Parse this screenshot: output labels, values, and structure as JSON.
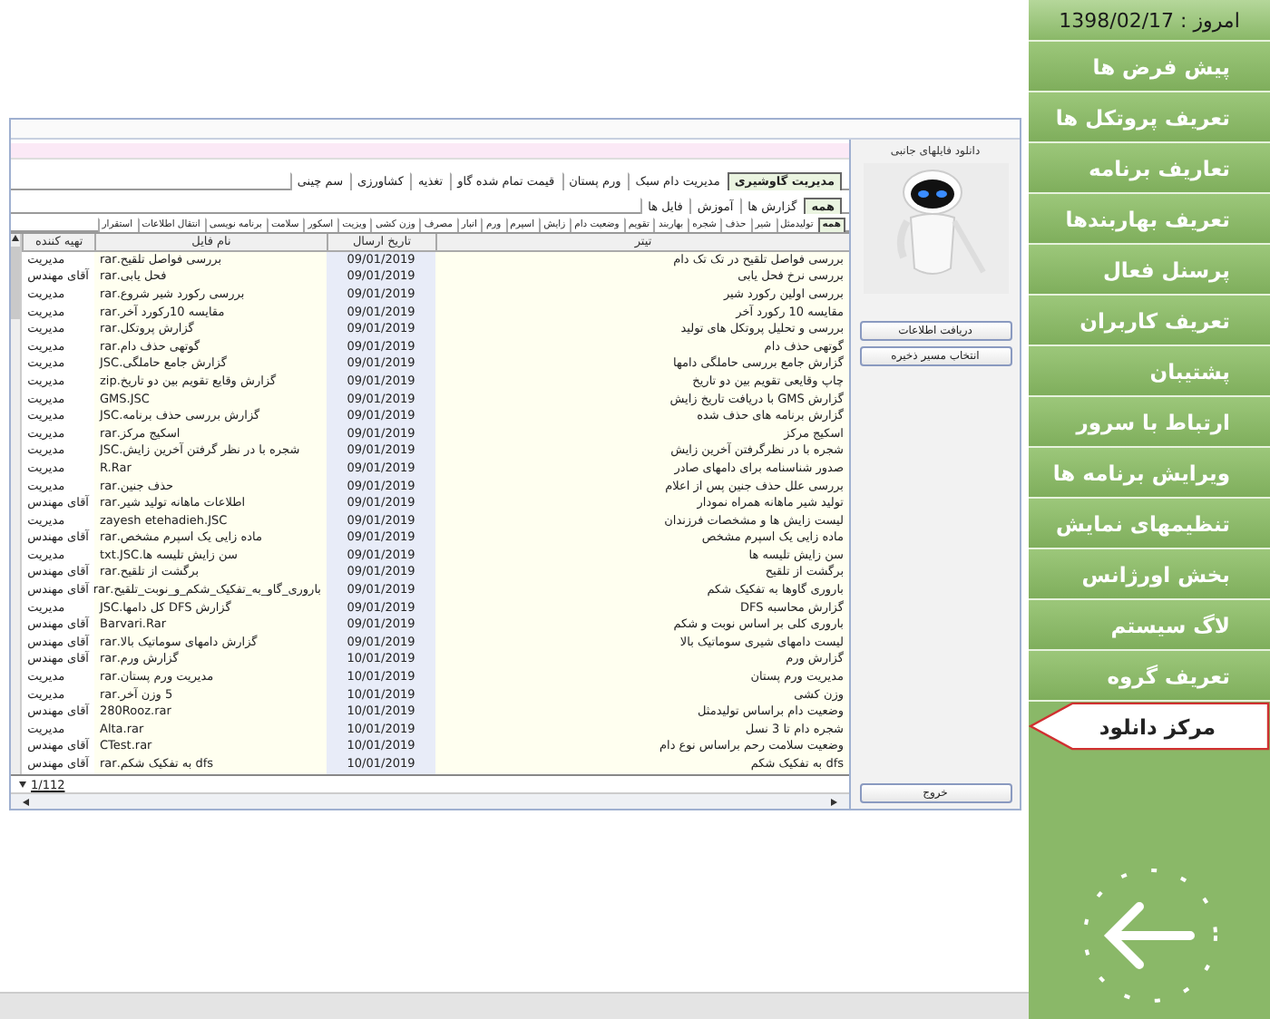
{
  "header": {
    "date_label": "امروز : 1398/02/17"
  },
  "sidebar": {
    "items": [
      {
        "label": "پیش فرض ها",
        "selected": false
      },
      {
        "label": "تعریف پروتکل ها",
        "selected": false
      },
      {
        "label": "تعاریف برنامه",
        "selected": false
      },
      {
        "label": "تعریف بهاربندها",
        "selected": false
      },
      {
        "label": "پرسنل فعال",
        "selected": false
      },
      {
        "label": "تعریف کاربران",
        "selected": false
      },
      {
        "label": "پشتیبان",
        "selected": false
      },
      {
        "label": "ارتباط با سرور",
        "selected": false
      },
      {
        "label": "ویرایش برنامه ها",
        "selected": false
      },
      {
        "label": "تنظیمهای نمایش",
        "selected": false
      },
      {
        "label": "بخش اورژانس",
        "selected": false
      },
      {
        "label": "لاگ سیستم",
        "selected": false
      },
      {
        "label": "تعریف گروه",
        "selected": false
      },
      {
        "label": "مرکز دانلود",
        "selected": true
      }
    ]
  },
  "window": {
    "main_tabs": [
      {
        "label": "مدیریت گاوشیری",
        "selected": true
      },
      {
        "label": "مدیریت دام سبک",
        "selected": false
      },
      {
        "label": "ورم پستان",
        "selected": false
      },
      {
        "label": "قیمت تمام شده گاو",
        "selected": false
      },
      {
        "label": "تغذیه",
        "selected": false
      },
      {
        "label": "کشاورزی",
        "selected": false
      },
      {
        "label": "سم چینی",
        "selected": false
      }
    ],
    "sub_tabs": [
      {
        "label": "همه",
        "selected": true
      },
      {
        "label": "گزارش ها",
        "selected": false
      },
      {
        "label": "آموزش",
        "selected": false
      },
      {
        "label": "فایل ها",
        "selected": false
      }
    ],
    "category_tabs": [
      {
        "label": "همه",
        "selected": true
      },
      {
        "label": "تولیدمثل",
        "selected": false
      },
      {
        "label": "شیر",
        "selected": false
      },
      {
        "label": "حذف",
        "selected": false
      },
      {
        "label": "شجره",
        "selected": false
      },
      {
        "label": "بهاربند",
        "selected": false
      },
      {
        "label": "تقویم",
        "selected": false
      },
      {
        "label": "وضعیت دام",
        "selected": false
      },
      {
        "label": "زایش",
        "selected": false
      },
      {
        "label": "اسپرم",
        "selected": false
      },
      {
        "label": "ورم",
        "selected": false
      },
      {
        "label": "انبار",
        "selected": false
      },
      {
        "label": "مصرف",
        "selected": false
      },
      {
        "label": "وزن کشی",
        "selected": false
      },
      {
        "label": "ویزیت",
        "selected": false
      },
      {
        "label": "اسکور",
        "selected": false
      },
      {
        "label": "سلامت",
        "selected": false
      },
      {
        "label": "برنامه نویسی",
        "selected": false
      },
      {
        "label": "انتقال اطلاعات",
        "selected": false
      },
      {
        "label": "استقرار",
        "selected": false
      }
    ],
    "table": {
      "columns": [
        "تیتر",
        "تاریخ ارسال",
        "نام فایل",
        "تهیه کننده"
      ],
      "rows": [
        {
          "title": "بررسی فواصل تلقیح در تک تک دام",
          "date": "09/01/2019",
          "file": "بررسی فواصل تلقیح.rar",
          "creator": "مدیریت"
        },
        {
          "title": "بررسی نرخ فحل یابی",
          "date": "09/01/2019",
          "file": "فحل یابی.rar",
          "creator": "آقای مهندس"
        },
        {
          "title": "بررسی اولین رکورد شیر",
          "date": "09/01/2019",
          "file": "بررسی رکورد شیر شروع.rar",
          "creator": "مدیریت"
        },
        {
          "title": "مقایسه 10 رکورد آخر",
          "date": "09/01/2019",
          "file": "مقایسه 10رکورد آخر.rar",
          "creator": "مدیریت"
        },
        {
          "title": "بررسی و تحلیل پروتکل های تولید",
          "date": "09/01/2019",
          "file": "گزارش پروتکل.rar",
          "creator": "مدیریت"
        },
        {
          "title": "گوتهی حذف دام",
          "date": "09/01/2019",
          "file": "گوتهی حذف دام.rar",
          "creator": "مدیریت"
        },
        {
          "title": "گزارش جامع بررسی حاملگی دامها",
          "date": "09/01/2019",
          "file": "گزارش جامع حاملگی.JSC",
          "creator": "مدیریت"
        },
        {
          "title": "چاپ وقایعی تقویم بین دو تاریخ",
          "date": "09/01/2019",
          "file": "گزارش وقایع تقویم بین دو تاریخ.zip",
          "creator": "مدیریت"
        },
        {
          "title": "گزارش GMS با دریافت تاریخ زایش",
          "date": "09/01/2019",
          "file": "GMS.JSC",
          "creator": "مدیریت"
        },
        {
          "title": "گزارش برنامه های حذف شده",
          "date": "09/01/2019",
          "file": "گزارش بررسی حذف برنامه.JSC",
          "creator": "مدیریت"
        },
        {
          "title": "اسکیج مرکز",
          "date": "09/01/2019",
          "file": "اسکیج مرکز.rar",
          "creator": "مدیریت"
        },
        {
          "title": "شجره با در نظرگرفتن آخرین زایش",
          "date": "09/01/2019",
          "file": "شجره با در نظر گرفتن آخرین زایش.JSC",
          "creator": "مدیریت"
        },
        {
          "title": "صدور شناسنامه برای دامهای صادر",
          "date": "09/01/2019",
          "file": "R.Rar",
          "creator": "مدیریت"
        },
        {
          "title": "بررسی علل حذف جنین پس از اعلام",
          "date": "09/01/2019",
          "file": "حذف جنین.rar",
          "creator": "مدیریت"
        },
        {
          "title": "تولید شیر ماهانه همراه نمودار",
          "date": "09/01/2019",
          "file": "اطلاعات ماهانه تولید شیر.rar",
          "creator": "آقای مهندس"
        },
        {
          "title": "لیست زایش ها و مشخصات فرزندان",
          "date": "09/01/2019",
          "file": "zayesh etehadieh.JSC",
          "creator": "مدیریت"
        },
        {
          "title": "ماده زایی یک اسپرم مشخص",
          "date": "09/01/2019",
          "file": "ماده زایی یک اسپرم مشخص.rar",
          "creator": "آقای مهندس"
        },
        {
          "title": "سن زایش تلیسه ها",
          "date": "09/01/2019",
          "file": "سن زایش تلیسه ها.txt.JSC",
          "creator": "مدیریت"
        },
        {
          "title": "برگشت از تلقیح",
          "date": "09/01/2019",
          "file": "برگشت از تلقیح.rar",
          "creator": "آقای مهندس"
        },
        {
          "title": "باروری گاوها به تفکیک شکم",
          "date": "09/01/2019",
          "file": "باروری_گاو_به_تفکیک_شکم_و_نوبت_تلقیح.rar",
          "creator": "آقای مهندس"
        },
        {
          "title": "گزارش محاسبه DFS",
          "date": "09/01/2019",
          "file": "گزارش DFS کل دامها.JSC",
          "creator": "مدیریت"
        },
        {
          "title": "باروری کلی بر اساس نوبت و شکم",
          "date": "09/01/2019",
          "file": "Barvari.Rar",
          "creator": "آقای مهندس"
        },
        {
          "title": "لیست دامهای شیری سوماتیک بالا",
          "date": "09/01/2019",
          "file": "گزارش دامهای سوماتیک بالا.rar",
          "creator": "آقای مهندس"
        },
        {
          "title": "گزارش ورم",
          "date": "10/01/2019",
          "file": "گزارش ورم.rar",
          "creator": "آقای مهندس"
        },
        {
          "title": "مدیریت ورم پستان",
          "date": "10/01/2019",
          "file": "مدیریت ورم پستان.rar",
          "creator": "مدیریت"
        },
        {
          "title": "وزن کشی",
          "date": "10/01/2019",
          "file": "5 وزن آخر.rar",
          "creator": "مدیریت"
        },
        {
          "title": "وضعیت دام براساس تولیدمثل",
          "date": "10/01/2019",
          "file": "280Rooz.rar",
          "creator": "آقای مهندس"
        },
        {
          "title": "شجره دام تا 3 نسل",
          "date": "10/01/2019",
          "file": "Alta.rar",
          "creator": "مدیریت"
        },
        {
          "title": "وضعیت سلامت رحم براساس نوع دام",
          "date": "10/01/2019",
          "file": "CTest.rar",
          "creator": "آقای مهندس"
        },
        {
          "title": "dfs به تفکیک شکم",
          "date": "10/01/2019",
          "file": "dfs به تفکیک شکم.rar",
          "creator": "آقای مهندس"
        }
      ]
    },
    "pager": "1/112",
    "side_panel": {
      "caption": "دانلود فایلهای جانبی",
      "buttons": [
        "دریافت اطلاعات",
        "انتخاب مسیر ذخیره"
      ],
      "exit_button": "خروج"
    }
  }
}
